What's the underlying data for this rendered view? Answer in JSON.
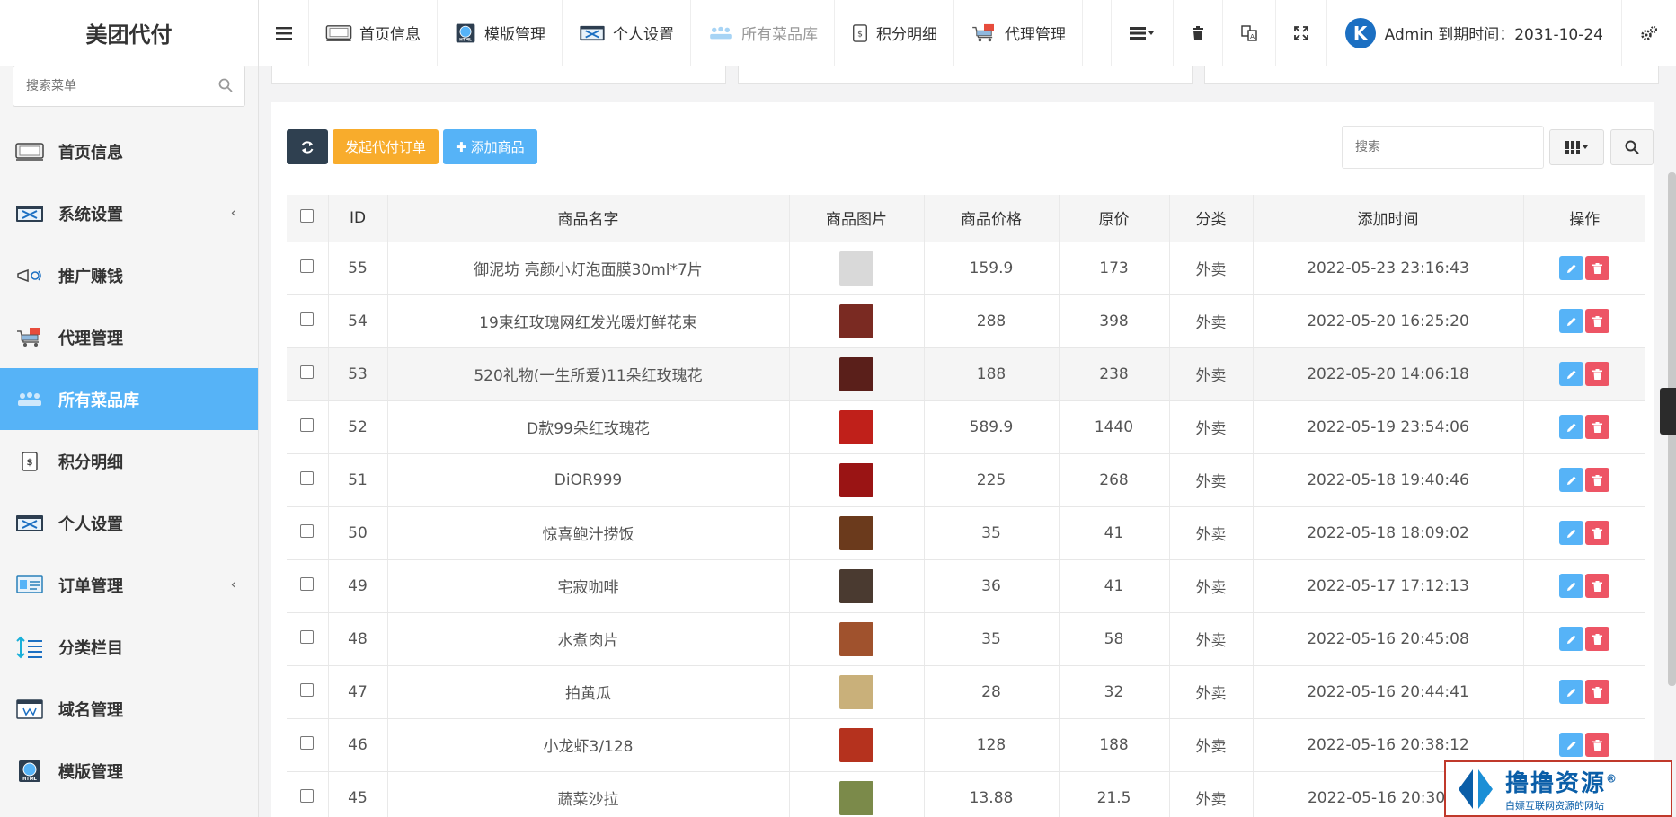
{
  "sidebar": {
    "brand": "美团代付",
    "search_placeholder": "搜索菜单",
    "items": [
      {
        "label": "首页信息"
      },
      {
        "label": "系统设置",
        "caret": "‹"
      },
      {
        "label": "推广赚钱"
      },
      {
        "label": "代理管理"
      },
      {
        "label": "所有菜品库"
      },
      {
        "label": "积分明细"
      },
      {
        "label": "个人设置"
      },
      {
        "label": "订单管理",
        "caret": "‹"
      },
      {
        "label": "分类栏目"
      },
      {
        "label": "域名管理"
      },
      {
        "label": "模版管理"
      }
    ]
  },
  "topbar": {
    "tabs": [
      {
        "label": "首页信息"
      },
      {
        "label": "模版管理"
      },
      {
        "label": "个人设置"
      },
      {
        "label": "所有菜品库"
      },
      {
        "label": "积分明细"
      },
      {
        "label": "代理管理"
      }
    ],
    "avatar_letter": "K",
    "user_text": "Admin 到期时间：2031-10-24"
  },
  "toolbar": {
    "launch_label": "发起代付订单",
    "add_label": "添加商品",
    "search_placeholder": "搜索"
  },
  "table": {
    "headers": [
      "ID",
      "商品名字",
      "商品图片",
      "商品价格",
      "原价",
      "分类",
      "添加时间",
      "操作"
    ],
    "rows": [
      {
        "id": "55",
        "name": "御泥坊 亮颜小灯泡面膜30ml*7片",
        "price": "159.9",
        "orig": "173",
        "cat": "外卖",
        "time": "2022-05-23 23:16:43",
        "thumb": "#d9d9d9"
      },
      {
        "id": "54",
        "name": "19束红玫瑰网红发光暖灯鲜花束",
        "price": "288",
        "orig": "398",
        "cat": "外卖",
        "time": "2022-05-20 16:25:20",
        "thumb": "#7a2a22"
      },
      {
        "id": "53",
        "name": "520礼物(一生所爱)11朵红玫瑰花",
        "price": "188",
        "orig": "238",
        "cat": "外卖",
        "time": "2022-05-20 14:06:18",
        "thumb": "#5a1f1a"
      },
      {
        "id": "52",
        "name": "D款99朵红玫瑰花",
        "price": "589.9",
        "orig": "1440",
        "cat": "外卖",
        "time": "2022-05-19 23:54:06",
        "thumb": "#c0201a"
      },
      {
        "id": "51",
        "name": "DiOR999",
        "price": "225",
        "orig": "268",
        "cat": "外卖",
        "time": "2022-05-18 19:40:46",
        "thumb": "#9a1414"
      },
      {
        "id": "50",
        "name": "惊喜鲍汁捞饭",
        "price": "35",
        "orig": "41",
        "cat": "外卖",
        "time": "2022-05-18 18:09:02",
        "thumb": "#6b3a1c"
      },
      {
        "id": "49",
        "name": "宅寂咖啡",
        "price": "36",
        "orig": "41",
        "cat": "外卖",
        "time": "2022-05-17 17:12:13",
        "thumb": "#4a3a30"
      },
      {
        "id": "48",
        "name": "水煮肉片",
        "price": "35",
        "orig": "58",
        "cat": "外卖",
        "time": "2022-05-16 20:45:08",
        "thumb": "#a0522d"
      },
      {
        "id": "47",
        "name": "拍黄瓜",
        "price": "28",
        "orig": "32",
        "cat": "外卖",
        "time": "2022-05-16 20:44:41",
        "thumb": "#c9b07a"
      },
      {
        "id": "46",
        "name": "小龙虾3/128",
        "price": "128",
        "orig": "188",
        "cat": "外卖",
        "time": "2022-05-16 20:38:12",
        "thumb": "#b5321e"
      },
      {
        "id": "45",
        "name": "蔬菜沙拉",
        "price": "13.88",
        "orig": "21.5",
        "cat": "外卖",
        "time": "2022-05-16 20:30:xx",
        "thumb": "#7b8a4a"
      }
    ]
  },
  "watermark": {
    "main": "撸撸资源",
    "sub": "白嫖互联网资源的网站",
    "reg": "®"
  }
}
